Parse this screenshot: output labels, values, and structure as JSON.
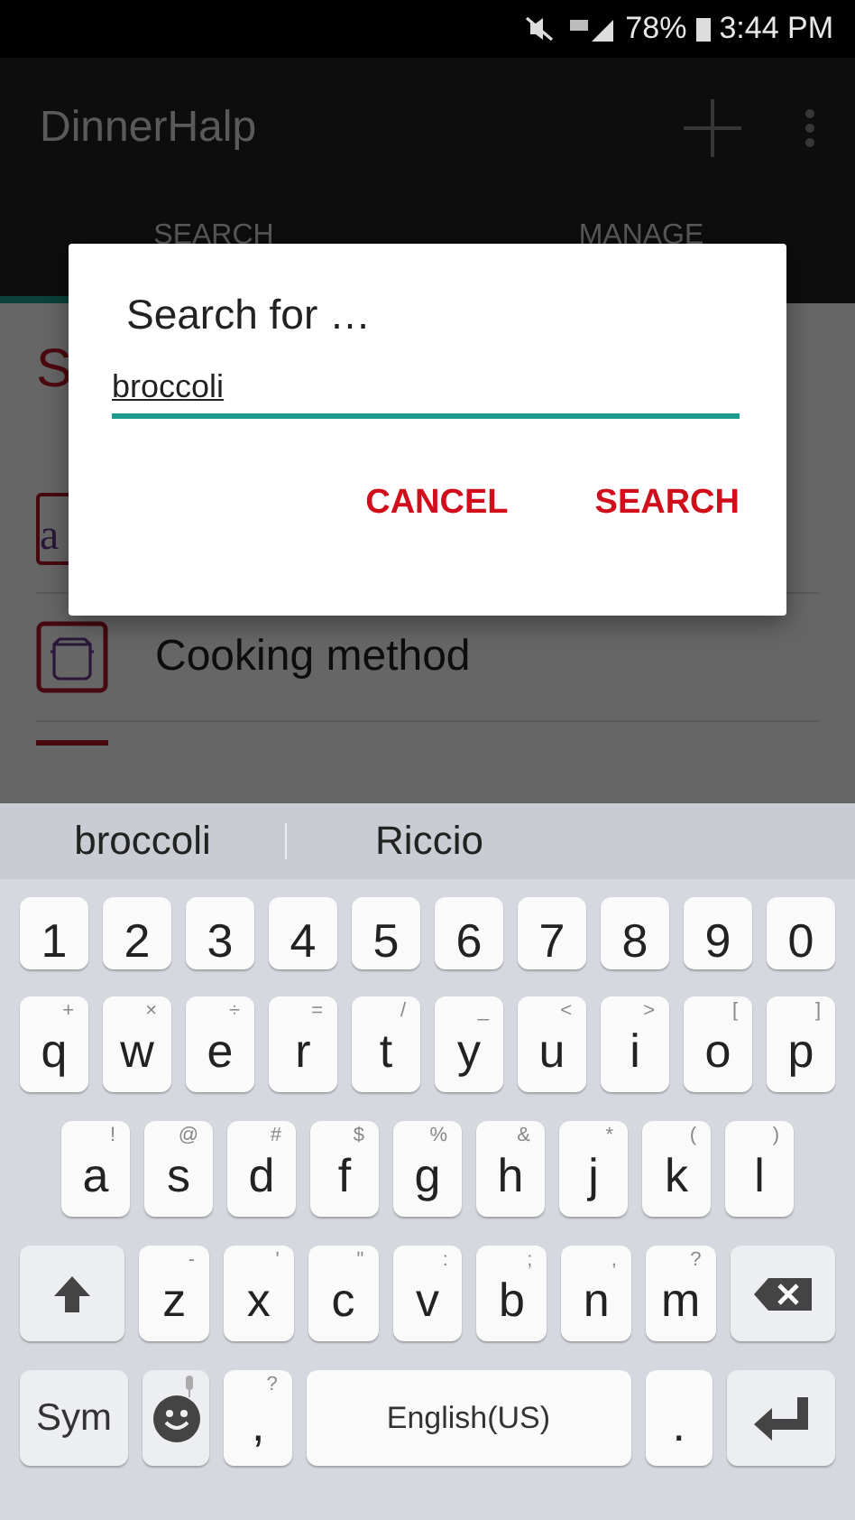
{
  "status_bar": {
    "battery": "78%",
    "time": "3:44 PM"
  },
  "app_bar": {
    "title": "DinnerHalp"
  },
  "tabs": [
    {
      "label": "SEARCH",
      "selected": true
    },
    {
      "label": "MANAGE",
      "selected": false
    }
  ],
  "content": {
    "heading": "S",
    "rows": [
      {
        "kind": "letter",
        "icon_letter": "a"
      },
      {
        "kind": "pot",
        "label": "Cooking method"
      },
      {
        "kind": "partial"
      }
    ]
  },
  "dialog": {
    "title": "Search for …",
    "value": "broccoli",
    "buttons": [
      "CANCEL",
      "SEARCH"
    ]
  },
  "suggestions": [
    "broccoli",
    "Riccio"
  ],
  "keyboard": {
    "number_row": [
      {
        "kind": "char",
        "label": "1"
      },
      {
        "kind": "char",
        "label": "2"
      },
      {
        "kind": "char",
        "label": "3"
      },
      {
        "kind": "char",
        "label": "4"
      },
      {
        "kind": "char",
        "label": "5"
      },
      {
        "kind": "char",
        "label": "6"
      },
      {
        "kind": "char",
        "label": "7"
      },
      {
        "kind": "char",
        "label": "8"
      },
      {
        "kind": "char",
        "label": "9"
      },
      {
        "kind": "char",
        "label": "0"
      }
    ],
    "top_row": [
      {
        "kind": "char",
        "label": "q",
        "hint": "+"
      },
      {
        "kind": "char",
        "label": "w",
        "hint": "×"
      },
      {
        "kind": "char",
        "label": "e",
        "hint": "÷"
      },
      {
        "kind": "char",
        "label": "r",
        "hint": "="
      },
      {
        "kind": "char",
        "label": "t",
        "hint": "/"
      },
      {
        "kind": "char",
        "label": "y",
        "hint": "_"
      },
      {
        "kind": "char",
        "label": "u",
        "hint": "<"
      },
      {
        "kind": "char",
        "label": "i",
        "hint": ">"
      },
      {
        "kind": "char",
        "label": "o",
        "hint": "["
      },
      {
        "kind": "char",
        "label": "p",
        "hint": "]"
      }
    ],
    "home_row": [
      {
        "kind": "char",
        "label": "a",
        "hint": "!"
      },
      {
        "kind": "char",
        "label": "s",
        "hint": "@"
      },
      {
        "kind": "char",
        "label": "d",
        "hint": "#"
      },
      {
        "kind": "char",
        "label": "f",
        "hint": "$"
      },
      {
        "kind": "char",
        "label": "g",
        "hint": "%"
      },
      {
        "kind": "char",
        "label": "h",
        "hint": "&"
      },
      {
        "kind": "char",
        "label": "j",
        "hint": "*"
      },
      {
        "kind": "char",
        "label": "k",
        "hint": "("
      },
      {
        "kind": "char",
        "label": "l",
        "hint": ")"
      }
    ],
    "lower_row": [
      {
        "kind": "shift"
      },
      {
        "kind": "char",
        "label": "z",
        "hint": "-"
      },
      {
        "kind": "char",
        "label": "x",
        "hint": "'"
      },
      {
        "kind": "char",
        "label": "c",
        "hint": "\""
      },
      {
        "kind": "char",
        "label": "v",
        "hint": ":"
      },
      {
        "kind": "char",
        "label": "b",
        "hint": ";"
      },
      {
        "kind": "char",
        "label": "n",
        "hint": ","
      },
      {
        "kind": "char",
        "label": "m",
        "hint": "?"
      },
      {
        "kind": "backspace"
      }
    ],
    "function_row": [
      {
        "kind": "sym",
        "label": "Sym"
      },
      {
        "kind": "emoji"
      },
      {
        "kind": "char",
        "label": ",",
        "hint": "?"
      },
      {
        "kind": "space",
        "label": "English(US)"
      },
      {
        "kind": "char",
        "label": "."
      },
      {
        "kind": "enter"
      }
    ]
  }
}
